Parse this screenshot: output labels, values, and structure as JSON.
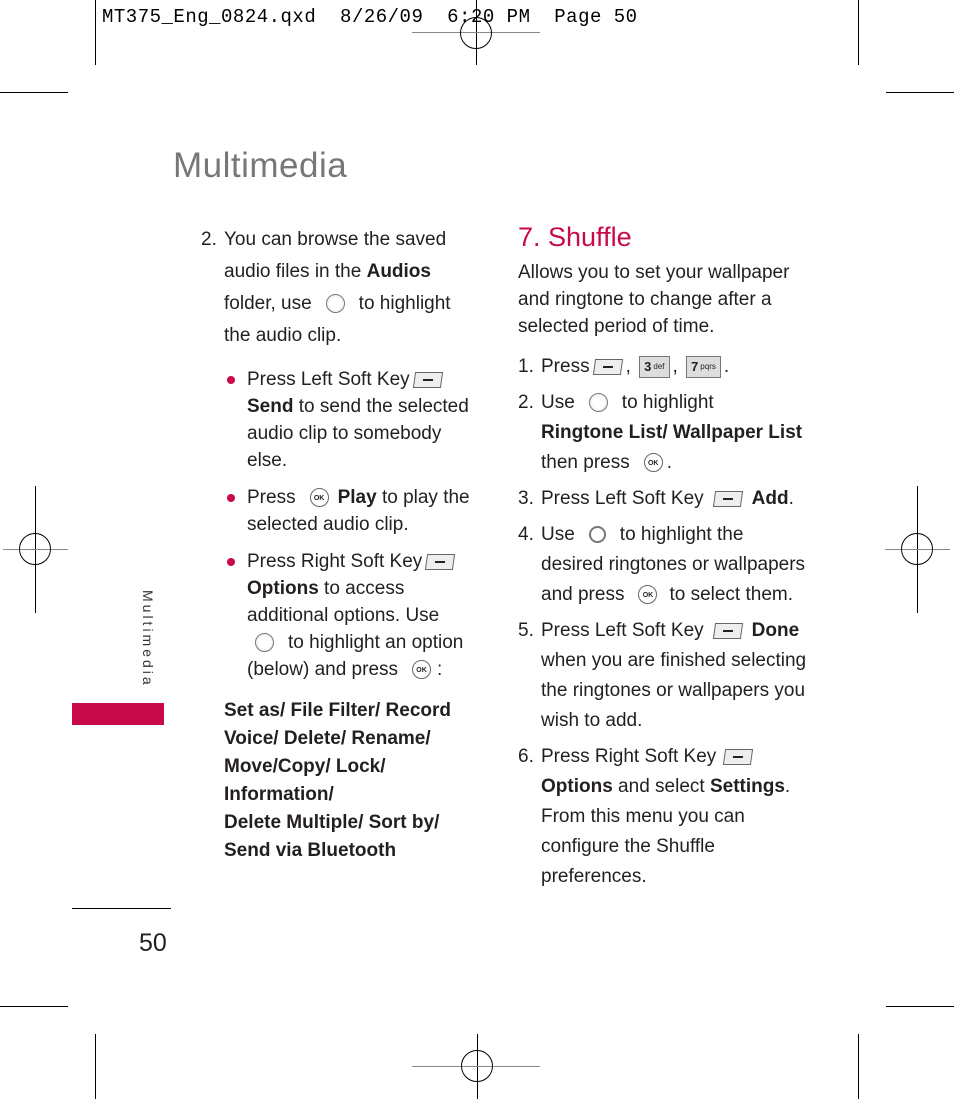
{
  "slug_line": "MT375_Eng_0824.qxd  8/26/09  6:20 PM  Page 50",
  "page_title": "Multimedia",
  "side_tab_label": "Multimedia",
  "page_number": "50",
  "accent_color": "#c8094a",
  "left_column": {
    "step2": {
      "number": "2.",
      "line1": "You can browse the saved",
      "line2_pre": "audio files in the ",
      "line2_bold": "Audios",
      "line3_pre": "folder, use",
      "line3_post": "to highlight",
      "line4": "the audio clip.",
      "nav_icon": "navigation-key-up-down-icon"
    },
    "bullets": [
      {
        "pre": "Press Left Soft Key",
        "icon": "left-soft-key-icon",
        "bold": "Send",
        "post": " to send the selected audio clip to somebody else."
      },
      {
        "pre": "Press",
        "icon": "ok-key-icon",
        "ok_text": "OK",
        "bold": "Play",
        "post": " to play the selected audio clip."
      },
      {
        "pre": "Press Right Soft Key",
        "icon": "right-soft-key-icon",
        "bold": "Options",
        "post1": " to access additional options. Use",
        "post2": "to highlight an option",
        "post3": "(below) and press",
        "post4": ":"
      }
    ],
    "options_list_lines": [
      "Set as/ File Filter/ Record",
      "Voice/ Delete/ Rename/",
      "Move/Copy/ Lock/",
      "Information/",
      "Delete Multiple/ Sort by/",
      "Send via Bluetooth"
    ]
  },
  "right_column": {
    "heading": "7. Shuffle",
    "intro": "Allows you to set your wallpaper and ringtone to change after a selected period of time.",
    "steps": [
      {
        "number": "1.",
        "pre": "Press",
        "keys": [
          {
            "digit": "3",
            "letters": "def"
          },
          {
            "digit": "7",
            "letters": "pqrs"
          }
        ]
      },
      {
        "number": "2.",
        "pre": "Use",
        "post": "to highlight",
        "bold": "Ringtone List/ Wallpaper List",
        "tail": "then press"
      },
      {
        "number": "3.",
        "pre": "Press Left Soft Key",
        "bold": "Add",
        "tail": "."
      },
      {
        "number": "4.",
        "pre": "Use",
        "post": "to highlight the",
        "line2": "desired ringtones or wallpapers",
        "line3_pre": "and press",
        "line3_post": "to select them."
      },
      {
        "number": "5.",
        "pre": "Press Left Soft Key",
        "bold": "Done",
        "rest": "when you are finished selecting the ringtones or wallpapers you wish to add."
      },
      {
        "number": "6.",
        "pre": "Press Right Soft Key",
        "bold1": "Options",
        "mid": " and select ",
        "bold2": "Settings",
        "rest": ". From this menu you can configure the Shuffle preferences."
      }
    ]
  }
}
